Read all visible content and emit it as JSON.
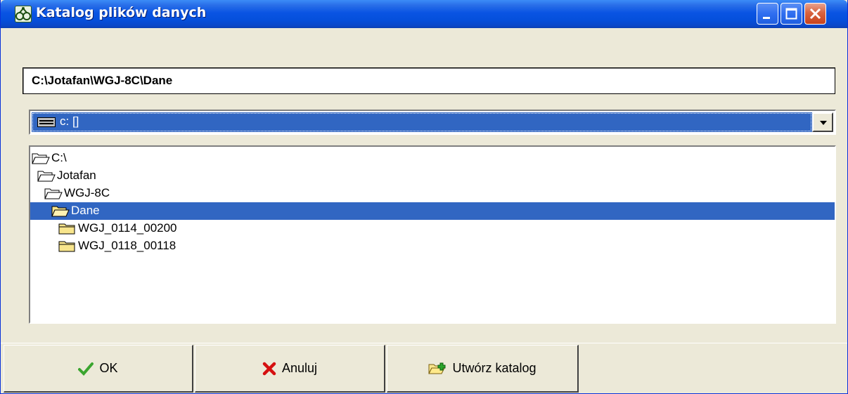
{
  "window": {
    "title": "Katalog plików danych",
    "controls": [
      "minimize-icon",
      "maximize-icon",
      "close-icon"
    ]
  },
  "path": {
    "value": "C:\\Jotafan\\WGJ-8C\\Dane"
  },
  "drive": {
    "selected": "c: []"
  },
  "tree": {
    "items": [
      {
        "label": "C:\\",
        "icon": "folder-open-icon",
        "selected": false
      },
      {
        "label": "Jotafan",
        "icon": "folder-open-icon",
        "selected": false
      },
      {
        "label": "WGJ-8C",
        "icon": "folder-open-icon",
        "selected": false
      },
      {
        "label": "Dane",
        "icon": "folder-open-icon",
        "selected": true
      },
      {
        "label": "WGJ_0114_00200",
        "icon": "folder-closed-icon",
        "selected": false
      },
      {
        "label": "WGJ_0118_00118",
        "icon": "folder-closed-icon",
        "selected": false
      }
    ]
  },
  "buttons": {
    "ok": {
      "label": "OK",
      "icon": "checkmark-icon"
    },
    "cancel": {
      "label": "Anuluj",
      "icon": "x-icon"
    },
    "create": {
      "label": "Utwórz katalog",
      "icon": "new-folder-icon"
    }
  },
  "colors": {
    "title_bar": "#0a54e3",
    "selection": "#3166c2",
    "face": "#ece9d8",
    "folder": "#f8e58c"
  }
}
